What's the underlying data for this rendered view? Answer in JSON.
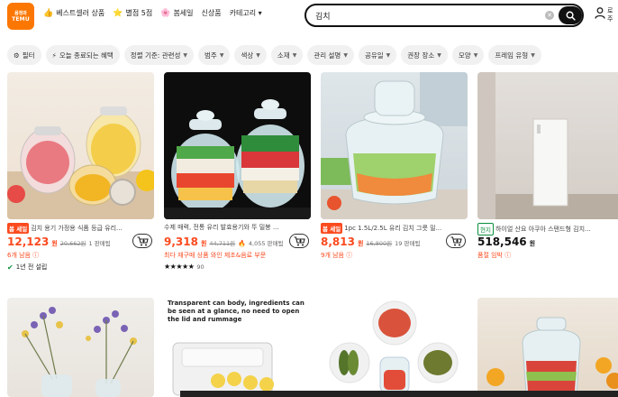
{
  "header": {
    "logo_line1": "음정와",
    "logo_line2": "TEMU",
    "nav": [
      {
        "icon": "👍",
        "label": "베스트셀러 상품"
      },
      {
        "icon": "⭐",
        "label": "별점 5점"
      },
      {
        "icon": "🌸",
        "label": "봄세일"
      },
      {
        "icon": "",
        "label": "신상품"
      },
      {
        "icon": "",
        "label": "카테고리 ▾"
      }
    ],
    "search_value": "김치",
    "user_line1": "로",
    "user_line2": "주"
  },
  "filters": [
    {
      "label": "필터",
      "icon": "⚙",
      "caret": false
    },
    {
      "label": "오늘 종료되는 혜택",
      "icon": "⚡",
      "caret": false
    },
    {
      "label": "정렬 기준: 관련성",
      "icon": "",
      "caret": true
    },
    {
      "label": "범주",
      "icon": "",
      "caret": true
    },
    {
      "label": "색상",
      "icon": "",
      "caret": true
    },
    {
      "label": "소재",
      "icon": "",
      "caret": true
    },
    {
      "label": "관리 설명",
      "icon": "",
      "caret": true
    },
    {
      "label": "공유일",
      "icon": "",
      "caret": true
    },
    {
      "label": "권장 장소",
      "icon": "",
      "caret": true
    },
    {
      "label": "모양",
      "icon": "",
      "caret": true
    },
    {
      "label": "프레임 유형",
      "icon": "",
      "caret": true
    }
  ],
  "products": [
    {
      "badge": "봄 세일",
      "badge_type": "sale",
      "title": "김치 용기 가정용 식품 등급 유리...",
      "price": "12,123",
      "unit": "원",
      "orig": "20,662원",
      "sold": "1 판매됨",
      "sub": "6개 남음 ⓘ",
      "sub_type": "orange",
      "extra": "1년 전 설립",
      "extra_type": "check",
      "rating": ""
    },
    {
      "badge": "",
      "badge_type": "",
      "title": "수제 매력, 전통 유리 발효용기와 뚜 밀봉 ...",
      "price": "9,318",
      "unit": "원",
      "orig": "44,711원",
      "sold": "4,055 판매됨",
      "sub": "최다 재구매 상품 와인 제조&음료 부문",
      "sub_type": "orange",
      "extra": "90",
      "extra_type": "stars",
      "rating": "★★★★★"
    },
    {
      "badge": "봄 세일",
      "badge_type": "sale",
      "title": "1pc 1.5L/2.5L 유리 김치 그릇 밀...",
      "price": "8,813",
      "unit": "원",
      "orig": "16,800원",
      "sold": "19 판매됨",
      "sub": "9개 남음 ⓘ",
      "sub_type": "orange",
      "extra": "",
      "extra_type": "",
      "rating": ""
    },
    {
      "badge": "현지",
      "badge_type": "local",
      "title": "하이얼 산요 아쿠아 스탠드형 김치...",
      "price": "518,546",
      "unit": "원",
      "orig": "",
      "sold": "",
      "sub": "품절 임박 ⓘ",
      "sub_type": "orange",
      "extra": "",
      "extra_type": "",
      "rating": ""
    }
  ],
  "row2": [
    {
      "caption": ""
    },
    {
      "caption": "Transparent can body, ingredients can be seen at a glance, no need to open the lid and rummage"
    },
    {
      "caption": ""
    },
    {
      "caption": ""
    }
  ],
  "colors": {
    "accent": "#fb7701",
    "sale": "#fb4a1e",
    "green": "#0a8f3c"
  }
}
